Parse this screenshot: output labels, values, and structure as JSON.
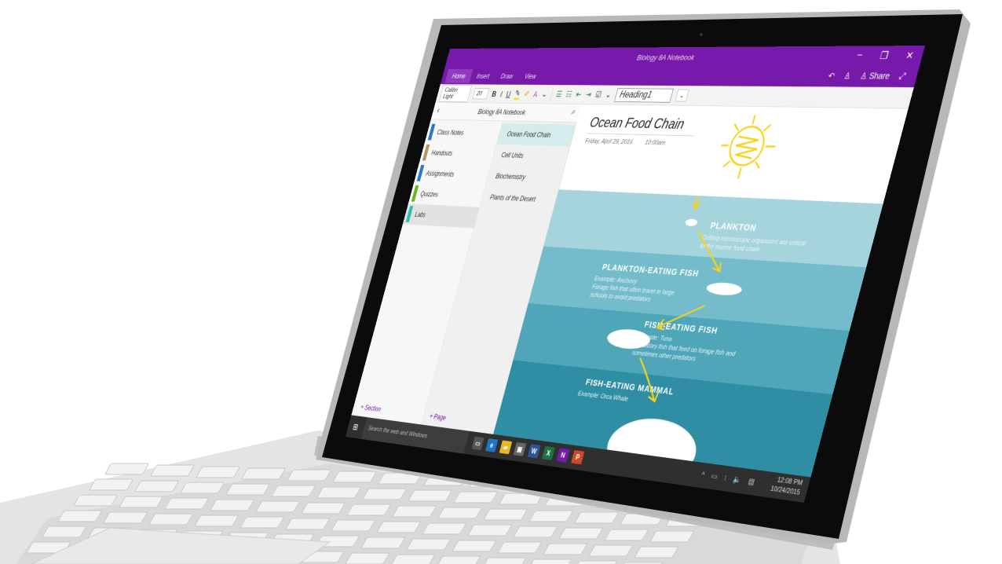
{
  "window": {
    "title": "Biology 8A Notebook",
    "minimize": "–",
    "restore": "❐",
    "close": "✕"
  },
  "ribbon": {
    "tabs": [
      {
        "label": "Home",
        "selected": true
      },
      {
        "label": "Insert"
      },
      {
        "label": "Draw"
      },
      {
        "label": "View"
      }
    ],
    "undo": "↶",
    "account": "♙",
    "share_label": "Share",
    "expand": "⤢",
    "font": "Calibri Light",
    "size": "20",
    "bold": "B",
    "italic": "I",
    "underline": "U",
    "highlight": "✎",
    "format_painter": "✐",
    "text_color": "A",
    "more": "⌄",
    "bullets": "☰",
    "numbering": "☷",
    "outdent": "⇤",
    "indent": "⇥",
    "todo": "☑",
    "style": "Heading1"
  },
  "notebook": {
    "back": "‹",
    "name": "Biology 8A Notebook",
    "search": "⌕",
    "sections": [
      {
        "label": "Class Notes",
        "color": "#2b78c5"
      },
      {
        "label": "Handouts",
        "color": "#b5956a"
      },
      {
        "label": "Assignments",
        "color": "#2b78c5"
      },
      {
        "label": "Quizzes",
        "color": "#6bb51e"
      },
      {
        "label": "Labs",
        "color": "#2dbfb0",
        "selected": true
      }
    ],
    "pages": [
      {
        "label": "Ocean Food Chain",
        "selected": true
      },
      {
        "label": "Cell Units"
      },
      {
        "label": "Biochemistry"
      },
      {
        "label": "Plants of the Desert"
      }
    ],
    "add_section": "+ Section",
    "add_page": "+ Page"
  },
  "page": {
    "title": "Ocean Food Chain",
    "date": "Friday, April 29, 2016",
    "time": "10:00am",
    "infographic": [
      {
        "heading": "PLANKTON",
        "desc": "Drifting microscopic organisms are critical to the marine food chain",
        "color": "#a6d4dc"
      },
      {
        "heading": "PLANKTON-EATING FISH",
        "desc": "Example: Anchovy\nForage fish that often travel in large schools to avoid predators",
        "color": "#74bccb"
      },
      {
        "heading": "FISH-EATING FISH",
        "desc": "Example: Tuna\nPredatory fish that feed on forage fish and sometimes other predators",
        "color": "#4ea6b8"
      },
      {
        "heading": "FISH-EATING MAMMAL",
        "desc": "Example: Orca Whale",
        "color": "#2f8ea3"
      }
    ],
    "ink_color": "#f5d31c"
  },
  "taskbar": {
    "search_placeholder": "Search the web and Windows",
    "mic": "🎤",
    "time": "12:08 PM",
    "date": "10/24/2015",
    "apps": [
      {
        "glyph": "▭",
        "color": "#555"
      },
      {
        "glyph": "e",
        "color": "#1e74c9"
      },
      {
        "glyph": "▰",
        "color": "#e8b923"
      },
      {
        "glyph": "▣",
        "color": "#666"
      },
      {
        "glyph": "W",
        "color": "#2b5797"
      },
      {
        "glyph": "X",
        "color": "#1e7145"
      },
      {
        "glyph": "N",
        "color": "#7719aa"
      },
      {
        "glyph": "P",
        "color": "#d24726"
      }
    ],
    "tray": [
      "^",
      "▭",
      "⁝",
      "🔈",
      "▤"
    ]
  },
  "accent": "#7719aa"
}
